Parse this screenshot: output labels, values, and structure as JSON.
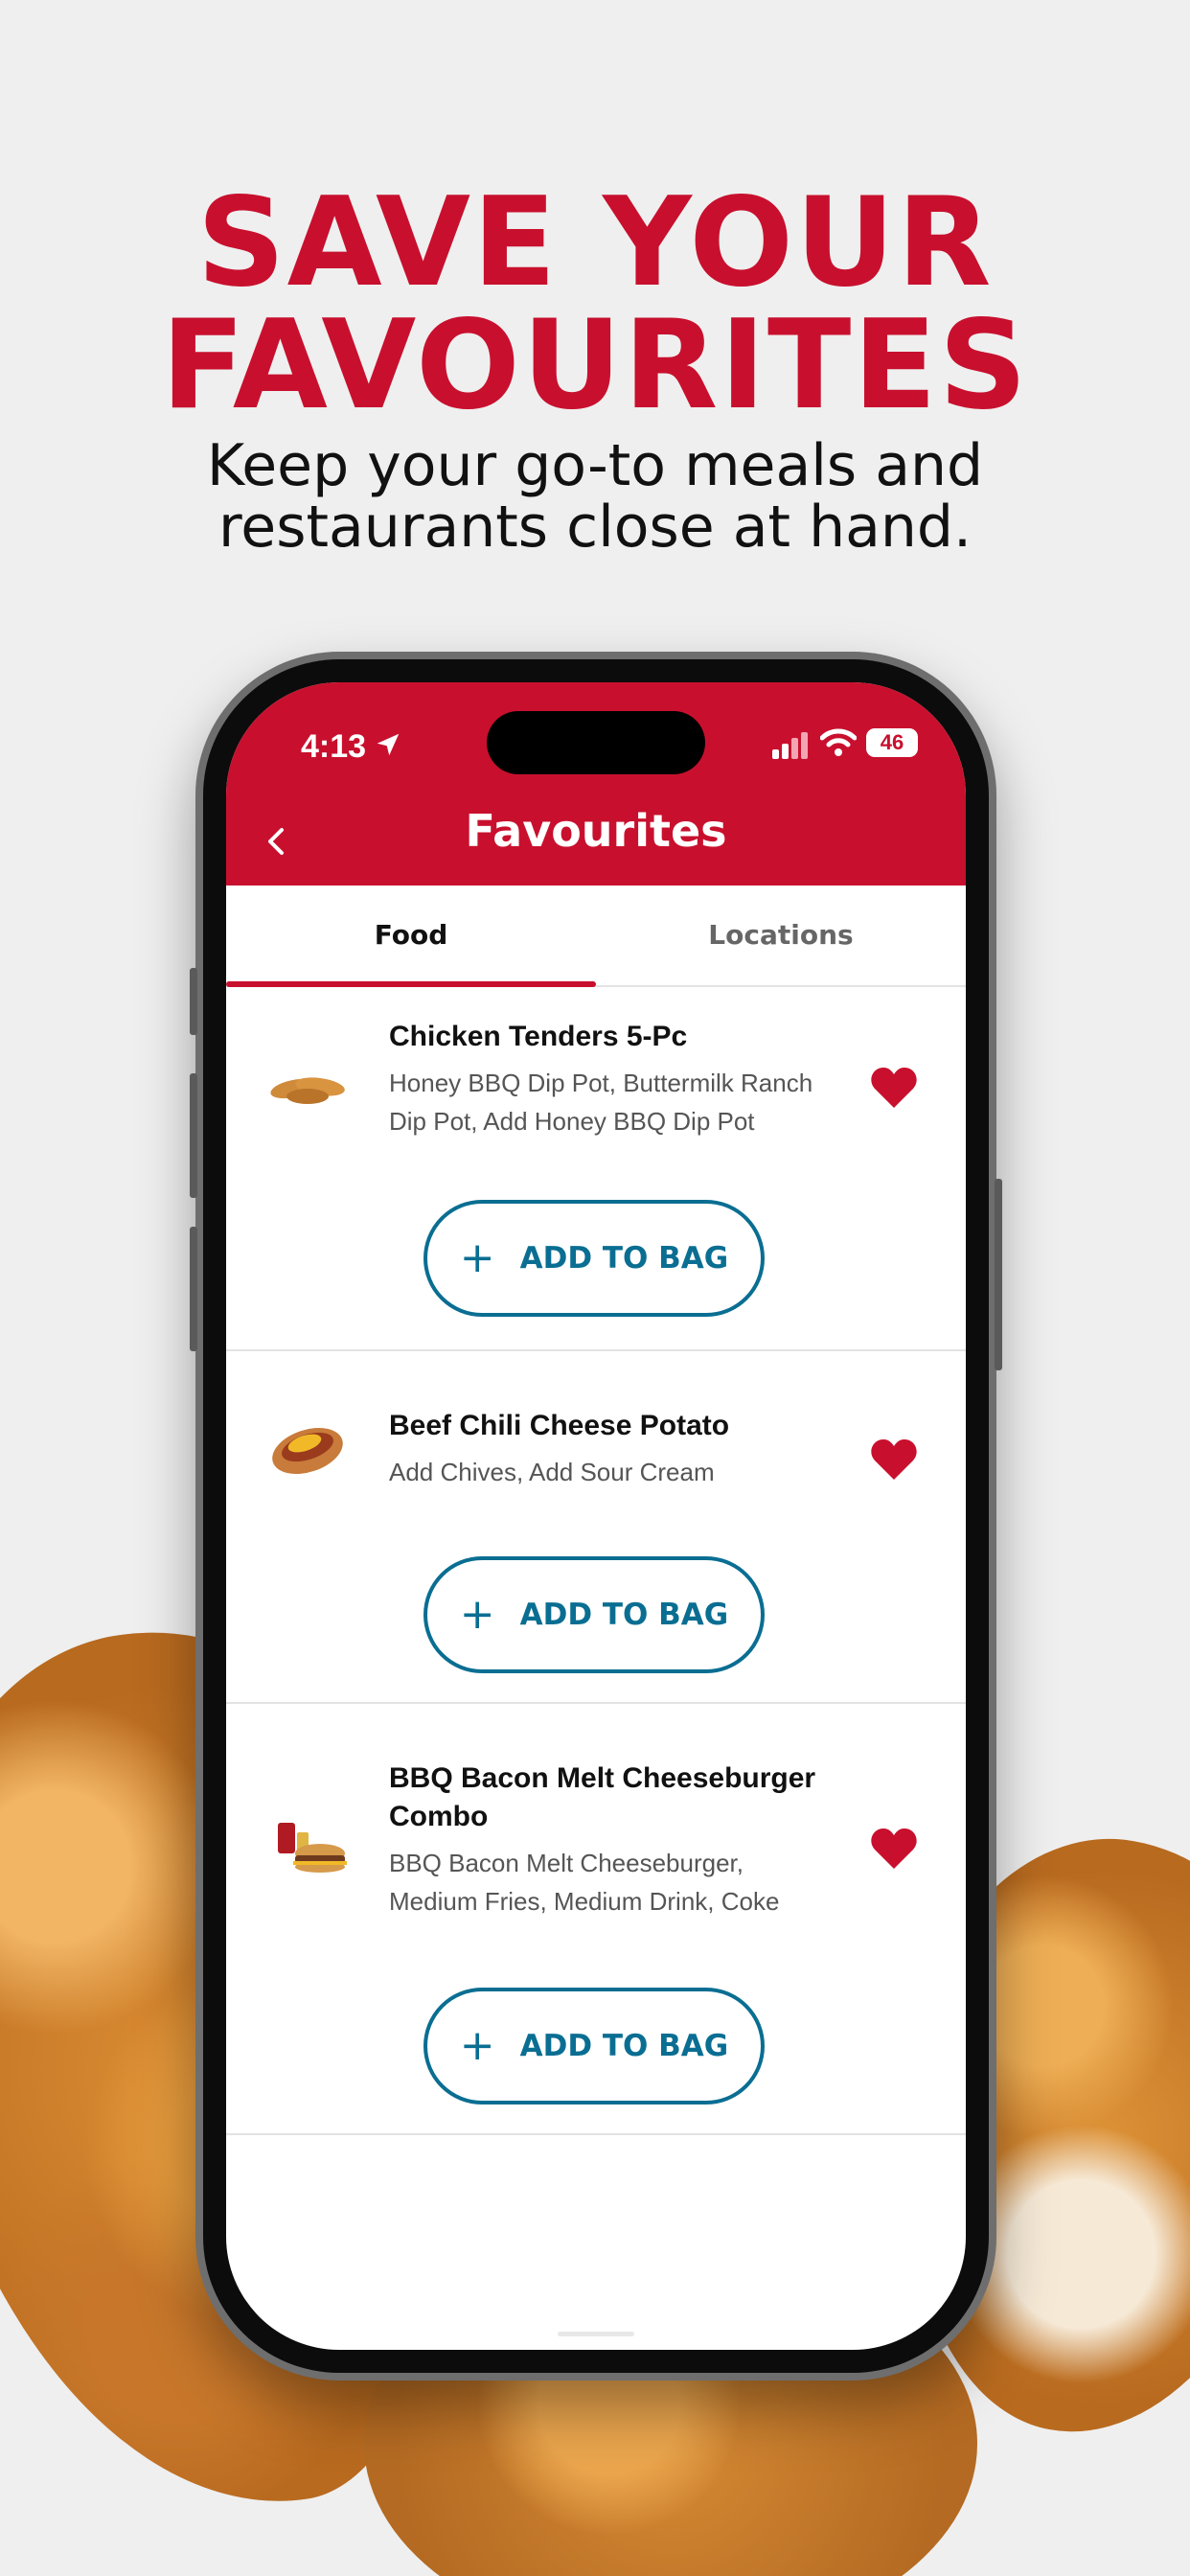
{
  "promo": {
    "title_line1": "SAVE YOUR",
    "title_line2": "FAVOURITES",
    "subtitle_line1": "Keep your go-to meals and",
    "subtitle_line2": "restaurants close at hand."
  },
  "status_bar": {
    "time": "4:13",
    "battery": "46"
  },
  "header": {
    "title": "Favourites"
  },
  "tabs": [
    {
      "label": "Food",
      "active": true
    },
    {
      "label": "Locations",
      "active": false
    }
  ],
  "items": [
    {
      "name": "Chicken Tenders 5-Pc",
      "desc_line1": "Honey BBQ Dip Pot, Buttermilk Ranch",
      "desc_line2": "Dip Pot, Add Honey BBQ Dip Pot",
      "add_label": "ADD TO BAG"
    },
    {
      "name": "Beef Chili Cheese Potato",
      "desc_line1": "Add Chives, Add Sour Cream",
      "add_label": "ADD TO BAG"
    },
    {
      "name_line1": "BBQ Bacon Melt Cheeseburger",
      "name_line2": "Combo",
      "desc_line1": "BBQ Bacon Melt Cheeseburger,",
      "desc_line2": "Medium Fries, Medium Drink, Coke",
      "add_label": "ADD TO BAG"
    }
  ],
  "icons": {
    "back": "chevron-left-icon",
    "favourite": "heart-icon",
    "add": "plus-icon"
  },
  "colors": {
    "brand_red": "#c8102e",
    "button_blue": "#0a6e92"
  }
}
